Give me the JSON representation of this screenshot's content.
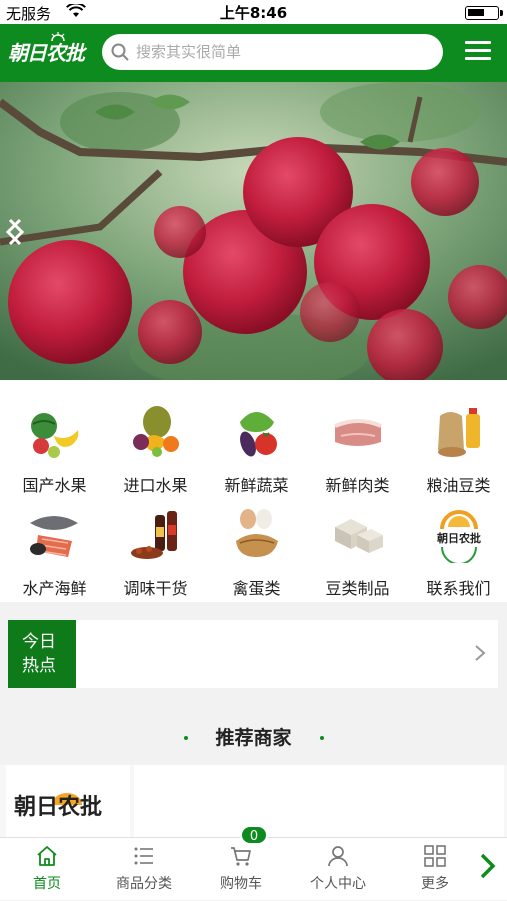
{
  "status_bar": {
    "carrier": "无服务",
    "time": "上午8:46"
  },
  "header": {
    "logo_text": "朝日农批",
    "search_placeholder": "搜索其实很简单",
    "menu_icon": "hamburger-menu-icon",
    "brand_color": "#0e8b1e"
  },
  "banner": {
    "subject": "red apples on tree branch",
    "prev_icon": "chevron-left-icon",
    "next_icon": "chevron-right-icon"
  },
  "categories": [
    {
      "label": "国产水果",
      "icon": "domestic-fruit-icon"
    },
    {
      "label": "进口水果",
      "icon": "imported-fruit-icon"
    },
    {
      "label": "新鲜蔬菜",
      "icon": "vegetables-icon"
    },
    {
      "label": "新鲜肉类",
      "icon": "meat-icon"
    },
    {
      "label": "粮油豆类",
      "icon": "grain-oil-icon"
    },
    {
      "label": "水产海鲜",
      "icon": "seafood-icon"
    },
    {
      "label": "调味干货",
      "icon": "seasoning-icon"
    },
    {
      "label": "禽蛋类",
      "icon": "poultry-eggs-icon"
    },
    {
      "label": "豆类制品",
      "icon": "tofu-icon"
    },
    {
      "label": "联系我们",
      "icon": "contact-logo-icon"
    }
  ],
  "hot": {
    "line1": "今日",
    "line2": "热点"
  },
  "recommend": {
    "title": "推荐商家"
  },
  "merchant": {
    "logo_text": "朝日农批"
  },
  "tabbar": {
    "tabs": [
      {
        "label": "首页",
        "icon": "home-icon",
        "active": true
      },
      {
        "label": "商品分类",
        "icon": "list-icon",
        "active": false
      },
      {
        "label": "购物车",
        "icon": "cart-icon",
        "active": false
      },
      {
        "label": "个人中心",
        "icon": "user-icon",
        "active": false
      },
      {
        "label": "更多",
        "icon": "grid-icon",
        "active": false
      }
    ],
    "cart_count": "0"
  }
}
